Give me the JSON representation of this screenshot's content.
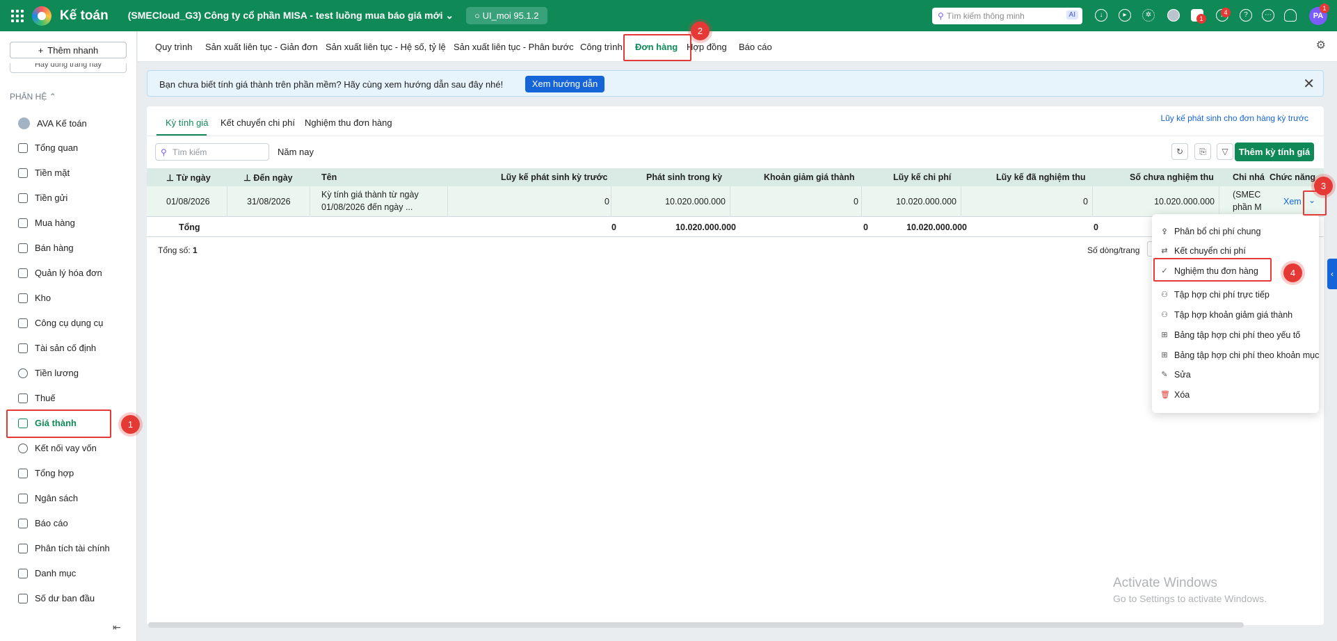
{
  "app": {
    "title": "Kế toán",
    "company": "(SMECloud_G3) Công ty cổ phần MISA - test luồng mua báo giá mới",
    "env": "UI_moi 95.1.2",
    "search_placeholder": "Tìm kiếm thông minh",
    "ai_badge": "AI",
    "avatar": "PA",
    "chat_badge": "1",
    "notif_badge": "4",
    "avatar_badge": "1"
  },
  "sidebar": {
    "quick_add": "Thêm nhanh",
    "cut_item": "Hãy dùng trang này",
    "section": "PHÂN HỆ",
    "items": [
      {
        "label": "AVA Kế toán"
      },
      {
        "label": "Tổng quan"
      },
      {
        "label": "Tiền mặt"
      },
      {
        "label": "Tiền gửi"
      },
      {
        "label": "Mua hàng"
      },
      {
        "label": "Bán hàng"
      },
      {
        "label": "Quản lý hóa đơn"
      },
      {
        "label": "Kho"
      },
      {
        "label": "Công cụ dụng cụ"
      },
      {
        "label": "Tài sản cố định"
      },
      {
        "label": "Tiền lương"
      },
      {
        "label": "Thuế"
      },
      {
        "label": "Giá thành"
      },
      {
        "label": "Kết nối vay vốn"
      },
      {
        "label": "Tổng hợp"
      },
      {
        "label": "Ngân sách"
      },
      {
        "label": "Báo cáo"
      },
      {
        "label": "Phân tích tài chính"
      },
      {
        "label": "Danh mục"
      },
      {
        "label": "Số dư ban đầu"
      }
    ]
  },
  "module_tabs": [
    "Quy trình",
    "Sản xuất liên tục - Giản đơn",
    "Sản xuất liên tục - Hệ số, tỷ lệ",
    "Sản xuất liên tục - Phân bước",
    "Công trình",
    "Đơn hàng",
    "Hợp đồng",
    "Báo cáo"
  ],
  "banner": {
    "text": "Bạn chưa biết tính giá thành trên phần mềm? Hãy cùng xem hướng dẫn sau đây nhé!",
    "button": "Xem hướng dẫn"
  },
  "subtabs": [
    "Kỳ tính giá",
    "Kết chuyển chi phí",
    "Nghiệm thu đơn hàng"
  ],
  "top_link": "Lũy kế phát sinh cho đơn hàng kỳ trước",
  "toolbar": {
    "search_placeholder": "Tìm kiếm",
    "period": "Năm nay",
    "add_button": "Thêm kỳ tính giá"
  },
  "table": {
    "headers": [
      "Từ ngày",
      "Đến ngày",
      "Tên",
      "Lũy kế phát sinh kỳ trước",
      "Phát sinh trong kỳ",
      "Khoản giảm giá thành",
      "Lũy kế chi phí",
      "Lũy kế đã nghiệm thu",
      "Số chưa nghiệm thu",
      "Chi nhá",
      "Chức năng"
    ],
    "row": {
      "from": "01/08/2026",
      "to": "31/08/2026",
      "name_line1": "Kỳ tính giá thành từ ngày",
      "name_line2": "01/08/2026 đến ngày ...",
      "prior": "0",
      "in_period": "10.020.000.000",
      "reduction": "0",
      "accumulated": "10.020.000.000",
      "accepted": "0",
      "not_accepted": "10.020.000.000",
      "branch_line1": "(SMEC",
      "branch_line2": "phần M",
      "action": "Xem"
    },
    "total": {
      "label": "Tổng",
      "prior": "0",
      "in_period": "10.020.000.000",
      "reduction": "0",
      "accumulated": "10.020.000.000",
      "accepted": "0"
    }
  },
  "footer": {
    "count_label": "Tổng số:",
    "count_value": "1",
    "per_page_label": "Số dòng/trang"
  },
  "dropdown": [
    "Phân bổ chi phí chung",
    "Kết chuyển chi phí",
    "Nghiệm thu đơn hàng",
    "Tập hợp chi phí trực tiếp",
    "Tập hợp khoản giảm giá thành",
    "Bảng tập hợp chi phí theo yếu tố",
    "Bảng tập hợp chi phí theo khoản mục",
    "Sửa",
    "Xóa"
  ],
  "markers": [
    "1",
    "2",
    "3",
    "4"
  ],
  "watermark": {
    "line1": "Activate Windows",
    "line2": "Go to Settings to activate Windows."
  },
  "colors": {
    "brand": "#0f8a57",
    "link": "#1565d8",
    "highlight": "#e53935"
  }
}
